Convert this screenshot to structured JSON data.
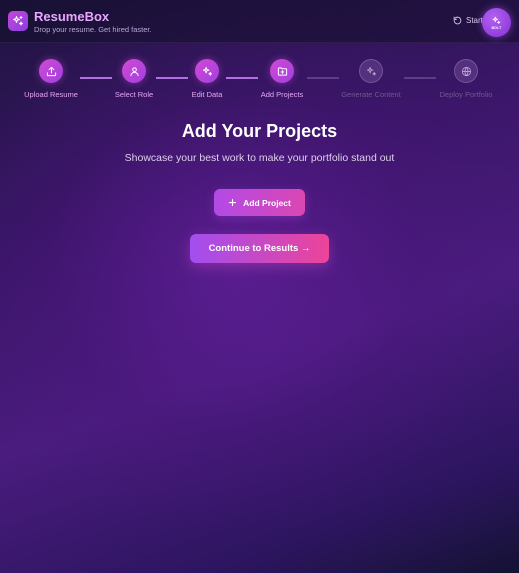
{
  "header": {
    "brand_title": "ResumeBox",
    "brand_tagline": "Drop your resume. Get hired faster.",
    "start_over_label": "Start",
    "badge_text": "BOLT"
  },
  "stepper": {
    "steps": [
      {
        "label": "Upload Resume",
        "icon": "upload-icon",
        "state": "active"
      },
      {
        "label": "Select Role",
        "icon": "user-icon",
        "state": "active"
      },
      {
        "label": "Edit Data",
        "icon": "sparkles-icon",
        "state": "active"
      },
      {
        "label": "Add Projects",
        "icon": "folder-icon",
        "state": "active"
      },
      {
        "label": "Generate Content",
        "icon": "sparkles-icon",
        "state": "inactive"
      },
      {
        "label": "Deploy Portfolio",
        "icon": "globe-icon",
        "state": "inactive"
      }
    ]
  },
  "main": {
    "title": "Add Your Projects",
    "subtitle": "Showcase your best work to make your portfolio stand out",
    "add_project_label": "Add Project",
    "continue_label": "Continue to Results →"
  },
  "colors": {
    "accent_pink": "#e04ca8",
    "accent_purple": "#a24ef0",
    "brand_text": "#e9a6ff",
    "inactive_label": "#6e5a8c"
  }
}
